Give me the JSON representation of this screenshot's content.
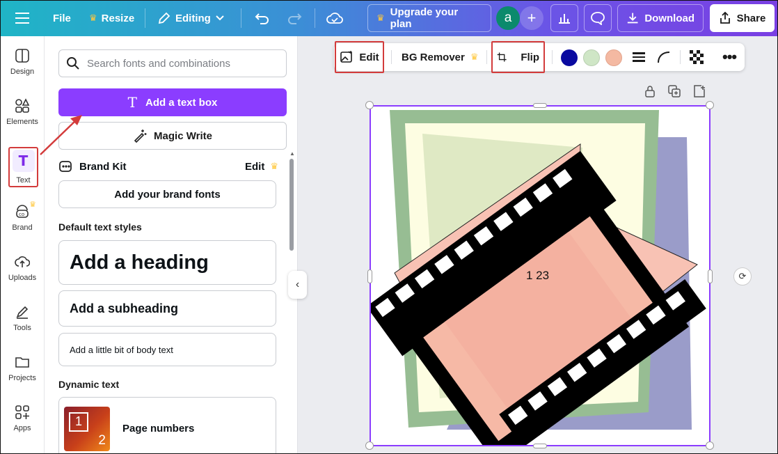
{
  "topbar": {
    "file_label": "File",
    "resize_label": "Resize",
    "editing_label": "Editing",
    "upgrade_label": "Upgrade your plan",
    "avatar_letter": "a",
    "download_label": "Download",
    "share_label": "Share"
  },
  "rail": {
    "items": [
      {
        "label": "Design",
        "icon": "design-icon"
      },
      {
        "label": "Elements",
        "icon": "elements-icon"
      },
      {
        "label": "Text",
        "icon": "text-icon"
      },
      {
        "label": "Brand",
        "icon": "brand-icon"
      },
      {
        "label": "Uploads",
        "icon": "uploads-icon"
      },
      {
        "label": "Tools",
        "icon": "tools-icon"
      },
      {
        "label": "Projects",
        "icon": "projects-icon"
      },
      {
        "label": "Apps",
        "icon": "apps-icon"
      }
    ]
  },
  "panel": {
    "search_placeholder": "Search fonts and combinations",
    "add_text_box_label": "Add a text box",
    "magic_write_label": "Magic Write",
    "brand_kit_label": "Brand Kit",
    "brand_kit_edit": "Edit",
    "add_brand_fonts_label": "Add your brand fonts",
    "default_styles_title": "Default text styles",
    "heading_label": "Add a heading",
    "subheading_label": "Add a subheading",
    "body_label": "Add a little bit of body text",
    "dynamic_title": "Dynamic text",
    "page_numbers_label": "Page numbers",
    "page_numbers_thumb_1": "1",
    "page_numbers_thumb_2": "2"
  },
  "context_toolbar": {
    "edit_label": "Edit",
    "bg_remover_label": "BG Remover",
    "flip_label": "Flip",
    "colors": [
      "#0a0aa0",
      "#cfe6c6",
      "#f4b9a2"
    ]
  },
  "canvas": {
    "page_number_text": "1 23"
  },
  "colors": {
    "accent": "#8b3dff",
    "annotation_red": "#d33b3b"
  }
}
